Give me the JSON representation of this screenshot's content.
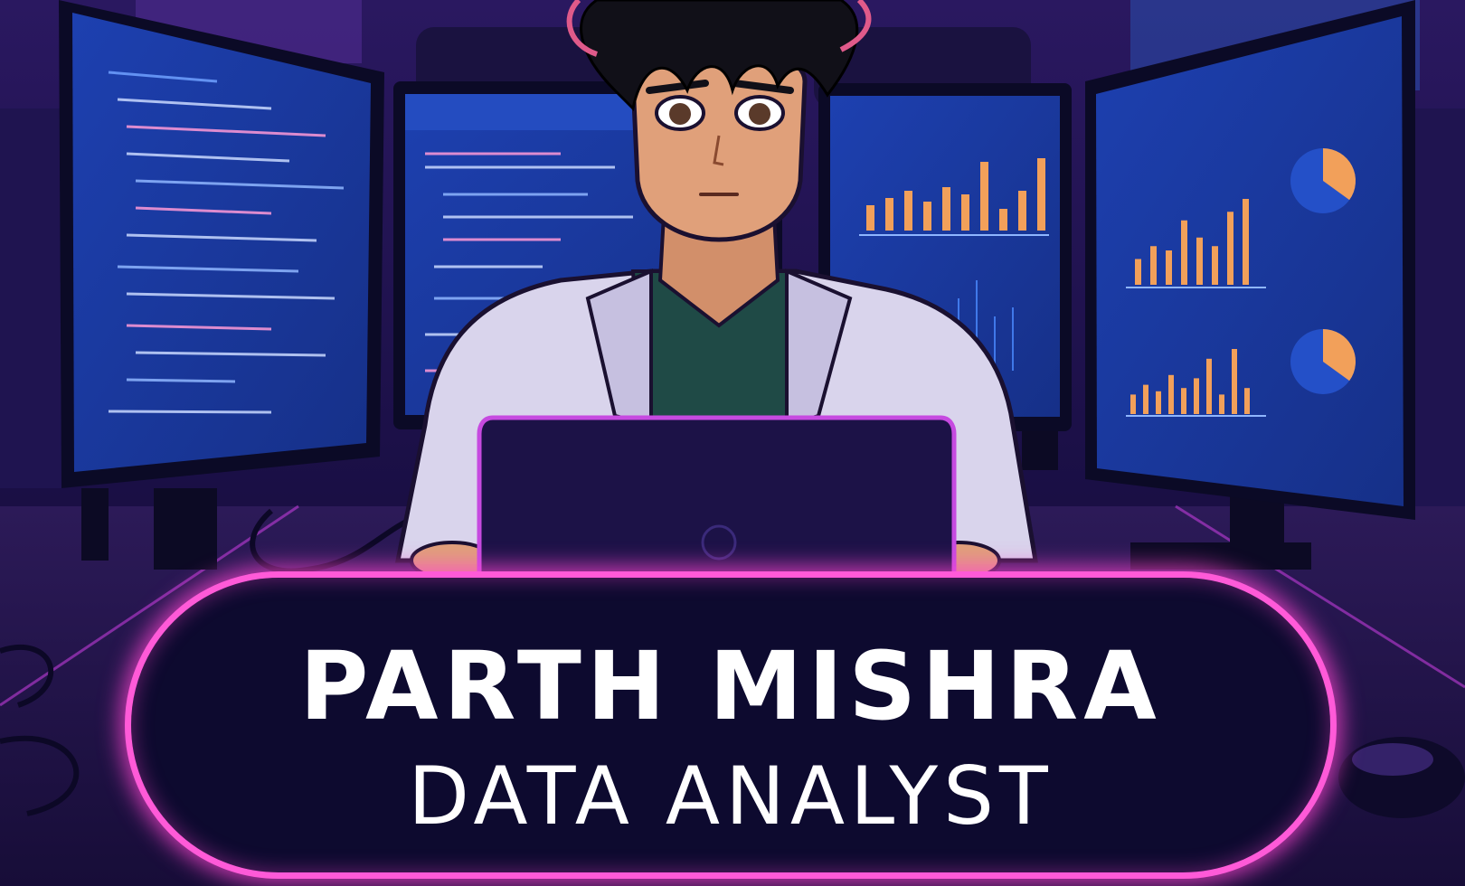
{
  "banner": {
    "name": "PARTH MISHRA",
    "role": "DATA ANALYST"
  },
  "colors": {
    "background": "#140a2e",
    "screen": "#1b3aa0",
    "neon_pink": "#ff5ad8",
    "bar_orange": "#f2a05a",
    "coat": "#d9d4ec",
    "shirt": "#1f4a46",
    "hair": "#111018",
    "skin": "#e0a07a"
  },
  "scene": {
    "monitors": [
      "code-editor",
      "code-editor",
      "bar-chart-dashboard",
      "analytics-dashboard"
    ],
    "charts": {
      "monitor3_bars": [
        0.35,
        0.45,
        0.55,
        0.4,
        0.6,
        0.5,
        0.95,
        0.3,
        0.55,
        1.0
      ],
      "monitor4_top_bars": [
        0.3,
        0.45,
        0.4,
        0.75,
        0.55,
        0.45,
        0.85,
        1.0
      ],
      "monitor4_bottom_bars": [
        0.3,
        0.45,
        0.35,
        0.6,
        0.4,
        0.55,
        0.85,
        0.3,
        1.0,
        0.4
      ],
      "pie_fraction": 0.35
    }
  }
}
